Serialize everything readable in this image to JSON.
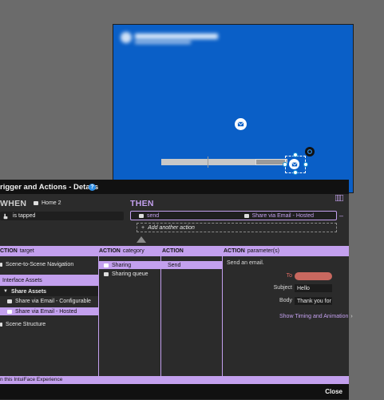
{
  "stage": {
    "background": "#0a5fc7"
  },
  "panel": {
    "title": "rigger and Actions - Details",
    "help_glyph": "?",
    "when_label": "WHEN",
    "when_item": "Home 2",
    "when_condition": "is tapped",
    "then_label": "THEN",
    "then_trigger": "send",
    "then_action": "Share via Email - Hosted",
    "add_action": "Add another action",
    "add_glyph": "+",
    "collapse_glyph": "–"
  },
  "columns": {
    "target_head": "CTION",
    "target_sub": "target",
    "category_head": "ACTION",
    "category_sub": "category",
    "action_head": "ACTION",
    "params_head": "ACTION",
    "params_sub": "parameter(s)"
  },
  "targets": {
    "scene_nav": "Scene-to-Scene Navigation",
    "interface_assets": "Interface Assets",
    "share_assets": "Share Assets",
    "share_configurable": "Share via Email - Configurable",
    "share_hosted": "Share via Email - Hosted",
    "scene_structure": "Scene Structure"
  },
  "categories": {
    "sharing": "Sharing",
    "sharing_queue": "Sharing queue"
  },
  "actions": {
    "send": "Send"
  },
  "params": {
    "description": "Send an email.",
    "to_label": "To",
    "subject_label": "Subject",
    "subject_value": "Hello",
    "body_label": "Body",
    "body_value": "Thank you for y",
    "show_timing": "Show Timing and Animation",
    "to_field_color": "#c8685f"
  },
  "bottom_bar": "n this IntuiFace Experience",
  "footer": {
    "close": "Close"
  },
  "icons": [
    "mail-icon",
    "help-icon",
    "hand-pointer-icon",
    "expand-icon",
    "chevron-right-icon"
  ],
  "accent": "#c3a0ee"
}
